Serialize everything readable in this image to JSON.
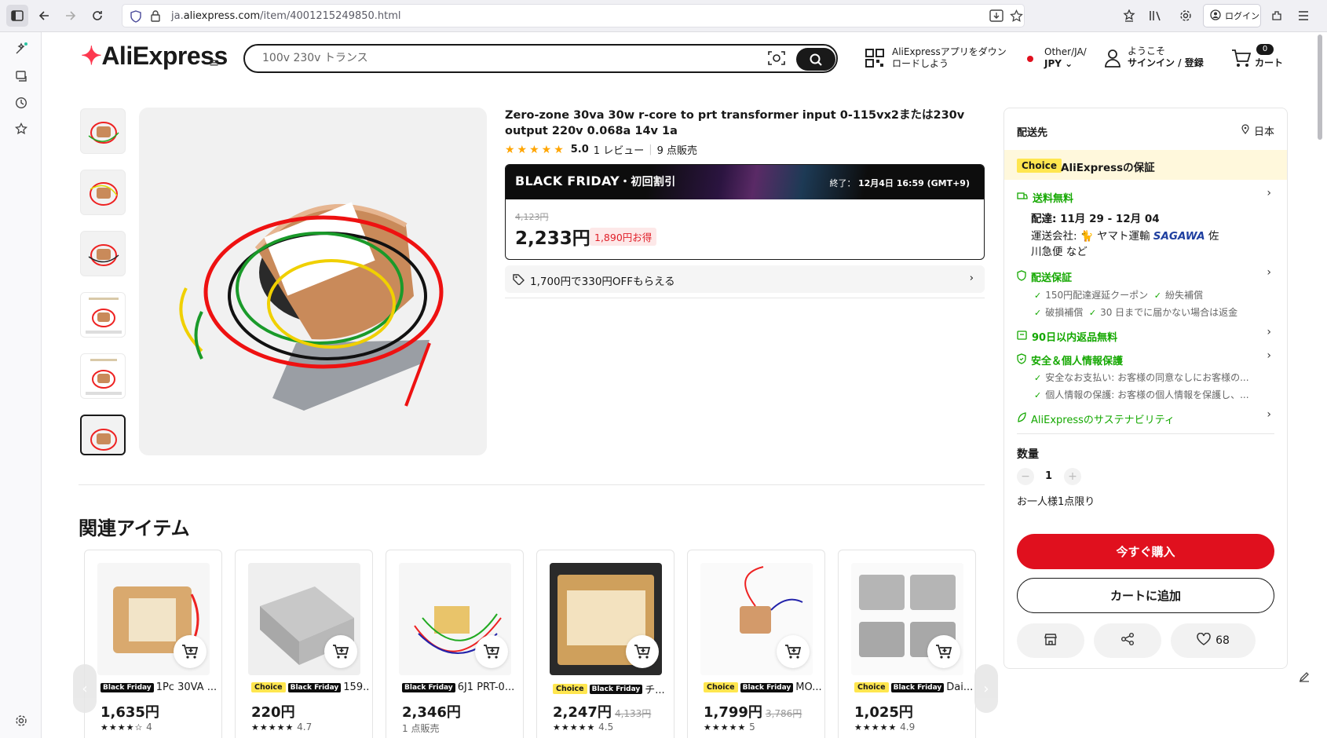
{
  "browser": {
    "url_prefix": "ja.",
    "url_domain": "aliexpress.com",
    "url_path": "/item/4001215249850.html",
    "login_label": "ログイン"
  },
  "header": {
    "logo": "AliExpress",
    "search_value": "100v 230v トランス",
    "app_promo_line1": "AliExpressアプリをダウン",
    "app_promo_line2": "ロードしよう",
    "region_line1": "Other/JA/",
    "region_line2": "JPY",
    "welcome_line1": "ようこそ",
    "welcome_line2": "サインイン / 登録",
    "cart_count": "0",
    "cart_label": "カート"
  },
  "product": {
    "title": "Zero-zone 30va 30w r-core to prt transformer input 0-115vx2または230v output 220v 0.068a 14v 1a",
    "rating_value": "5.0",
    "rating_stars": 5,
    "reviews": "1 レビュー",
    "sold": "9 点販売",
    "promo_title": "BLACK FRIDAY",
    "promo_sub": "・初回割引",
    "promo_end_label": "終了：",
    "promo_end_time": "12月4日 16:59 (GMT+9)",
    "old_price": "4,123円",
    "price": "2,233円",
    "savings": "1,890円お得",
    "coupon": "1,700円で330円OFFもらえる"
  },
  "related": {
    "title": "関連アイテム",
    "items": [
      {
        "tags": [
          "Black Friday"
        ],
        "name": "1Pc 30VA ...",
        "price": "1,635円",
        "old": "",
        "rating": "4",
        "stars": "★★★★☆",
        "sold": ""
      },
      {
        "tags": [
          "Choice",
          "Black Friday"
        ],
        "name": "159...",
        "price": "220円",
        "old": "",
        "rating": "4.7",
        "stars": "★★★★★",
        "sold": ""
      },
      {
        "tags": [
          "Black Friday"
        ],
        "name": "6J1 PRT-0...",
        "price": "2,346円",
        "old": "",
        "rating": "",
        "stars": "",
        "sold": "1 点販売"
      },
      {
        "tags": [
          "Choice",
          "Black Friday"
        ],
        "name": "チ...",
        "price": "2,247円",
        "old": "4,133円",
        "rating": "4.5",
        "stars": "★★★★★",
        "sold": ""
      },
      {
        "tags": [
          "Choice",
          "Black Friday"
        ],
        "name": "MO...",
        "price": "1,799円",
        "old": "3,786円",
        "rating": "5",
        "stars": "★★★★★",
        "sold": ""
      },
      {
        "tags": [
          "Choice",
          "Black Friday"
        ],
        "name": "Dai...",
        "price": "1,025円",
        "old": "",
        "rating": "4.9",
        "stars": "★★★★★",
        "sold": ""
      }
    ]
  },
  "panel": {
    "ship_to_label": "配送先",
    "ship_to_country": "日本",
    "choice_tag": "Choice",
    "guarantee": "AliExpressの保証",
    "free_shipping": "送料無料",
    "delivery": "配達: 11月 29 - 12月 04",
    "carriers_label": "運送会社:",
    "carrier1": "ヤマト運輸",
    "carrier2": "SAGAWA",
    "carrier2_tail": "佐",
    "carriers_line2": "川急便 など",
    "delivery_guarantee": "配送保証",
    "dg_item1": "150円配達遅延クーポン",
    "dg_item2": "紛失補償",
    "dg_item3": "破損補償",
    "dg_item4": "30 日までに届かない場合は返金",
    "returns": "90日以内返品無料",
    "security": "安全＆個人情報保護",
    "sec_item1": "安全なお支払い: お客様の同意なしにお客様の...",
    "sec_item2": "個人情報の保護: お客様の個人情報を保護し、...",
    "sustainability": "AliExpressのサステナビリティ",
    "qty_label": "数量",
    "qty_value": "1",
    "limit": "お一人様1点限り",
    "buy_now": "今すぐ購入",
    "add_to_cart": "カートに追加",
    "wishlist_count": "68"
  },
  "colors": {
    "accent_red": "#e0101e",
    "green": "#14a800",
    "choice_yellow": "#ffe64f"
  }
}
